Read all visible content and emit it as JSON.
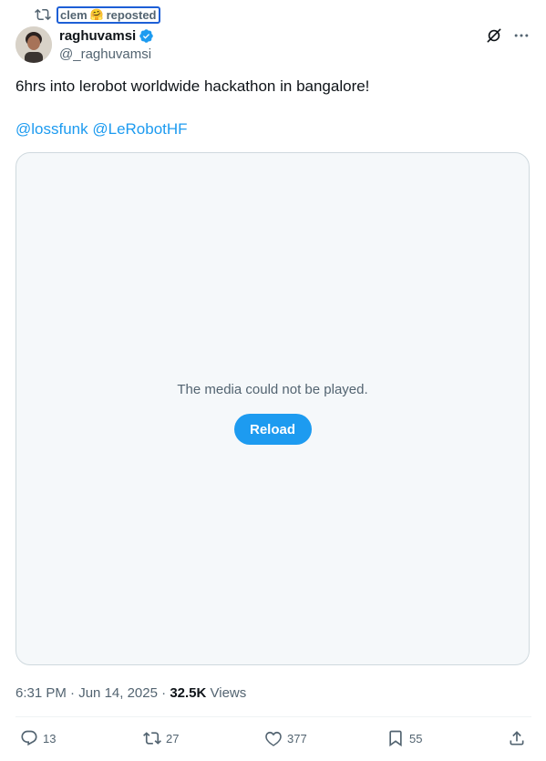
{
  "repost": {
    "user": "clem",
    "emoji": "🤗",
    "label": "reposted"
  },
  "author": {
    "name": "raghuvamsi",
    "handle": "@_raghuvamsi"
  },
  "tweet": {
    "text": "6hrs into lerobot worldwide hackathon in bangalore!",
    "mentions": [
      "@lossfunk",
      "@LeRobotHF"
    ]
  },
  "media": {
    "error_message": "The media could not be played.",
    "reload_label": "Reload"
  },
  "meta": {
    "time": "6:31 PM",
    "date": "Jun 14, 2025",
    "views_count": "32.5K",
    "views_label": "Views",
    "separator": "·"
  },
  "actions": {
    "replies": "13",
    "reposts": "27",
    "likes": "377",
    "bookmarks": "55"
  },
  "icons": [
    "retweet-icon",
    "verified-badge-icon",
    "grok-icon",
    "more-icon",
    "reply-icon",
    "like-icon",
    "bookmark-icon",
    "share-icon"
  ],
  "colors": {
    "accent": "#1d9bf0",
    "secondary_text": "#536471",
    "media_background": "#f5f8fa"
  }
}
